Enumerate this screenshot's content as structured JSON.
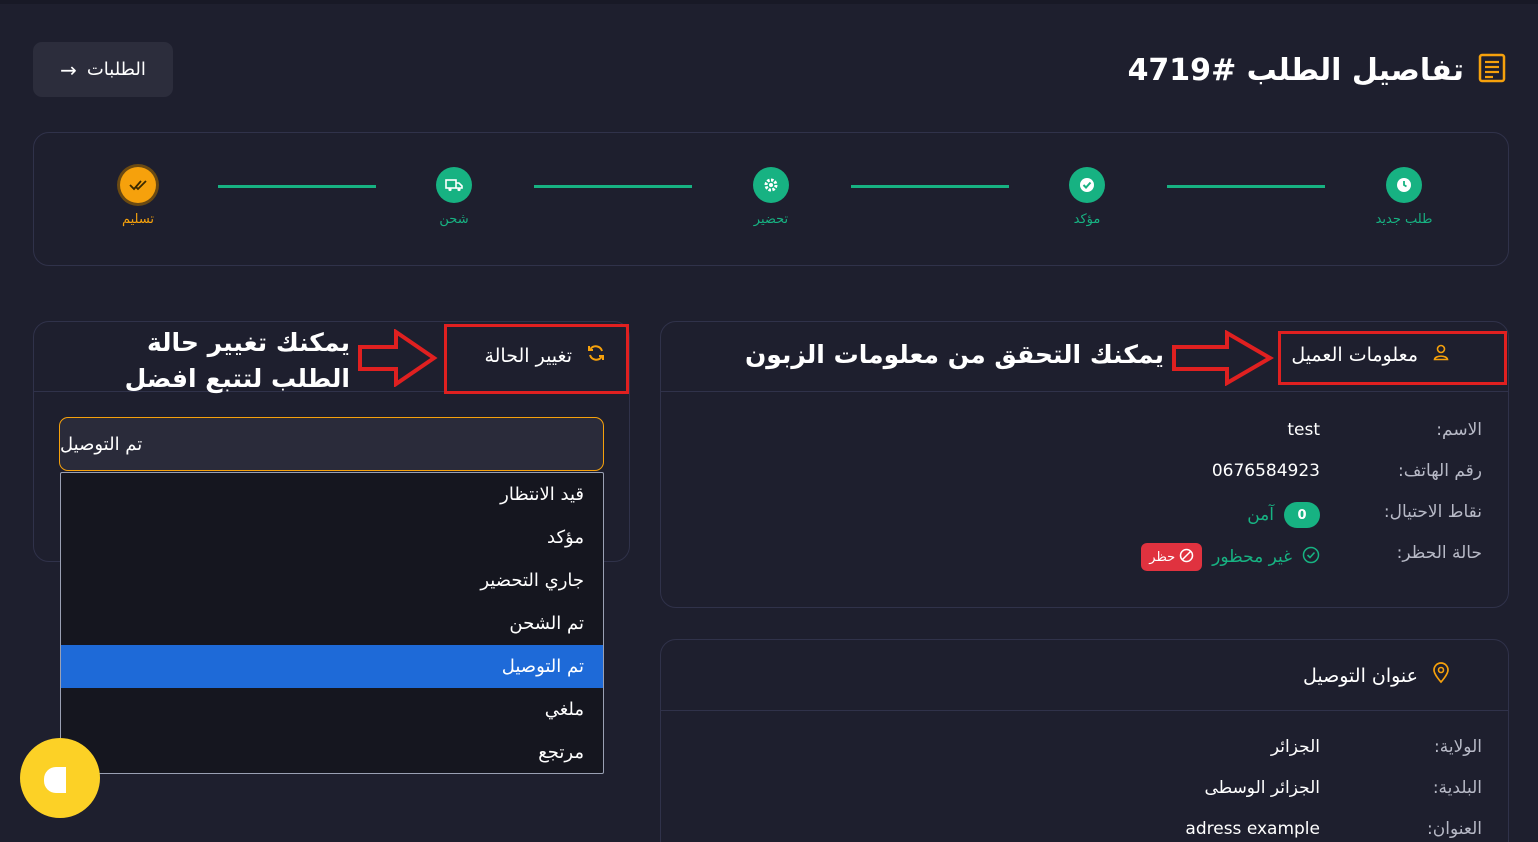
{
  "header": {
    "back_label": "الطلبات",
    "page_title": "تفاصيل الطلب #4719"
  },
  "stepper": {
    "steps": [
      {
        "label": "طلب جديد",
        "icon": "clock-icon",
        "state": "done"
      },
      {
        "label": "مؤكد",
        "icon": "check-icon",
        "state": "done"
      },
      {
        "label": "تحضير",
        "icon": "gear-icon",
        "state": "done"
      },
      {
        "label": "شحن",
        "icon": "truck-icon",
        "state": "done"
      },
      {
        "label": "تسليم",
        "icon": "double-check-icon",
        "state": "active"
      }
    ]
  },
  "status_card": {
    "title": "تغيير الحالة",
    "icon": "refresh-icon",
    "selected_value": "تم التوصيل",
    "options": [
      "قيد الانتظار",
      "مؤكد",
      "جاري التحضير",
      "تم الشحن",
      "تم التوصيل",
      "ملغي",
      "مرتجع"
    ],
    "annotation_line1": "يمكنك تغيير حالة",
    "annotation_line2": "الطلب لتتبع افضل"
  },
  "customer_card": {
    "title": "معلومات العميل",
    "icon": "user-icon",
    "annotation": "يمكنك التحقق من معلومات الزبون",
    "fields": {
      "name_label": "الاسم:",
      "name_value": "test",
      "phone_label": "رقم الهاتف:",
      "phone_value": "0676584923",
      "fraud_label": "نقاط الاحتيال:",
      "fraud_score": "0",
      "fraud_status": "آمن",
      "ban_label": "حالة الحظر:",
      "ban_status": "غير محظور",
      "ban_button": "حظر"
    }
  },
  "address_card": {
    "title": "عنوان التوصيل",
    "icon": "location-pin-icon",
    "fields": {
      "wilaya_label": "الولاية:",
      "wilaya_value": "الجزائر",
      "commune_label": "البلدية:",
      "commune_value": "الجزائر الوسطى",
      "address_label": "العنوان:",
      "address_value": "adress example"
    }
  },
  "colors": {
    "background": "#1e1f2e",
    "accent_orange": "#f6a10c",
    "success_green": "#17b282",
    "annotation_red": "#e02020",
    "selected_blue": "#1e6ad8"
  }
}
